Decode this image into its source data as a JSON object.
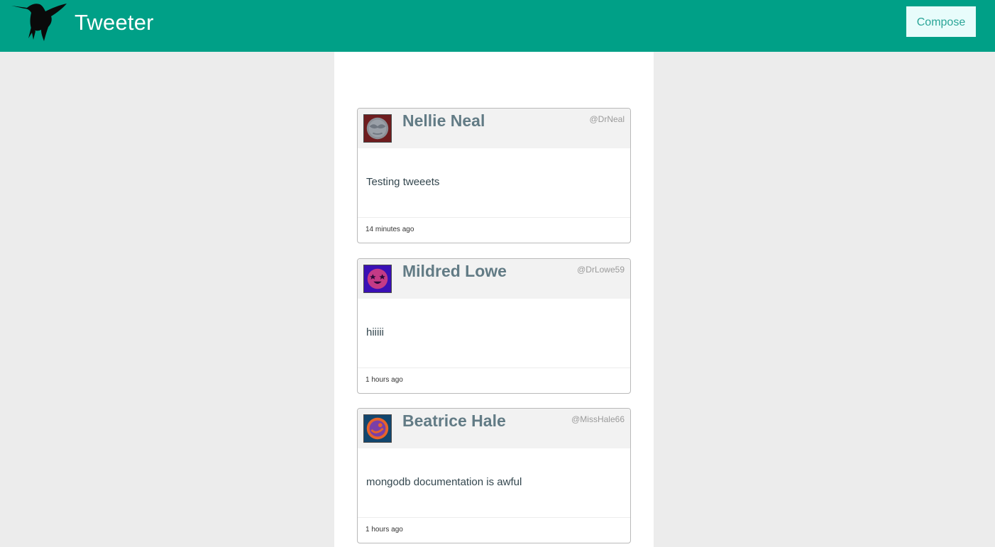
{
  "navbar": {
    "brand": "Tweeter",
    "compose_label": "Compose",
    "background_color": "#00a087",
    "logo_icon": "hummingbird-icon"
  },
  "tweets": [
    {
      "name": "Nellie Neal",
      "handle": "@DrNeal",
      "text": "Testing tweeets",
      "time": "14 minutes ago",
      "avatar_icon": "avatar-gray-face-icon"
    },
    {
      "name": "Mildred Lowe",
      "handle": "@DrLowe59",
      "text": "hiiiii",
      "time": "1 hours ago",
      "avatar_icon": "avatar-pink-face-icon"
    },
    {
      "name": "Beatrice Hale",
      "handle": "@MissHale66",
      "text": "mongodb documentation is awful",
      "time": "1 hours ago",
      "avatar_icon": "avatar-orange-face-icon"
    }
  ]
}
